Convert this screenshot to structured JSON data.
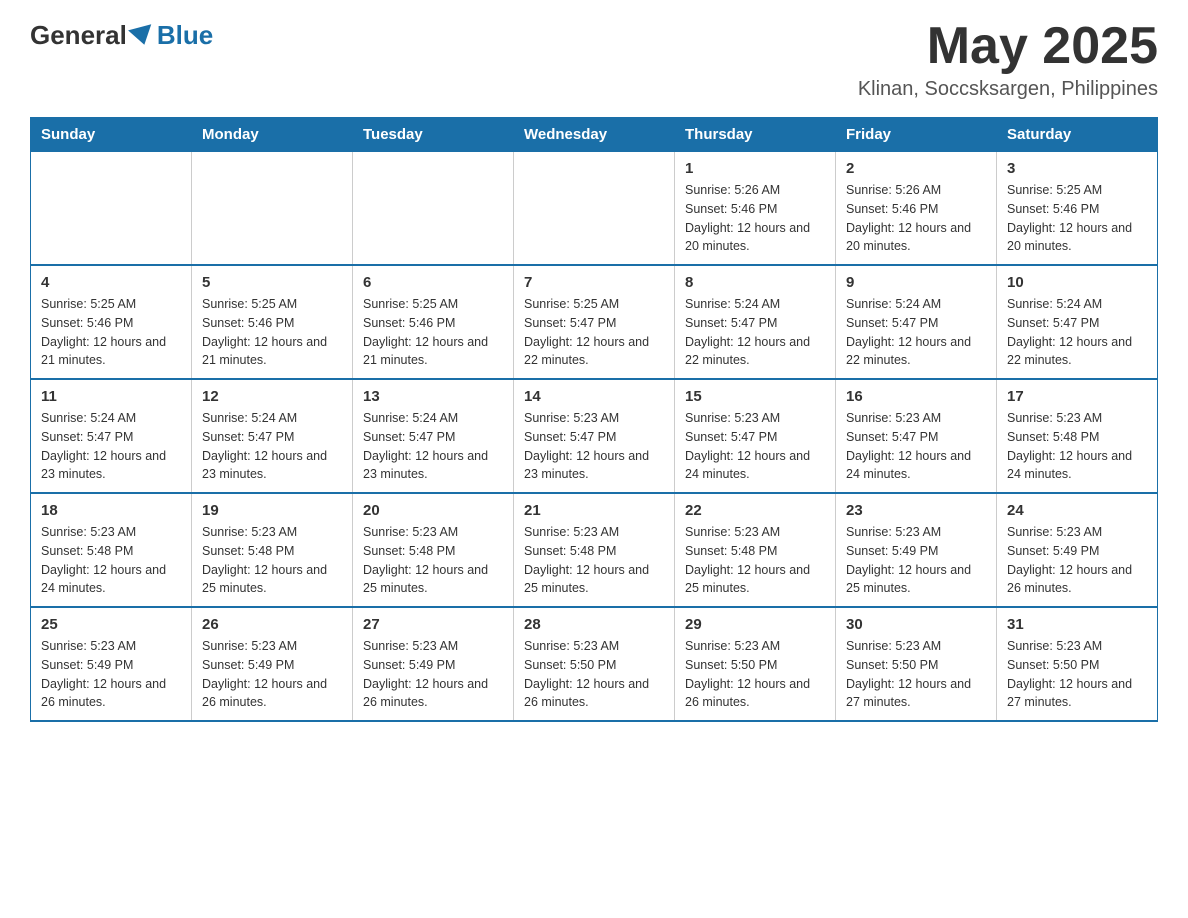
{
  "header": {
    "logo": {
      "general": "General",
      "blue": "Blue"
    },
    "title": "May 2025",
    "location": "Klinan, Soccsksargen, Philippines"
  },
  "days_of_week": [
    "Sunday",
    "Monday",
    "Tuesday",
    "Wednesday",
    "Thursday",
    "Friday",
    "Saturday"
  ],
  "weeks": [
    {
      "days": [
        {
          "number": "",
          "info": ""
        },
        {
          "number": "",
          "info": ""
        },
        {
          "number": "",
          "info": ""
        },
        {
          "number": "",
          "info": ""
        },
        {
          "number": "1",
          "info": "Sunrise: 5:26 AM\nSunset: 5:46 PM\nDaylight: 12 hours and 20 minutes."
        },
        {
          "number": "2",
          "info": "Sunrise: 5:26 AM\nSunset: 5:46 PM\nDaylight: 12 hours and 20 minutes."
        },
        {
          "number": "3",
          "info": "Sunrise: 5:25 AM\nSunset: 5:46 PM\nDaylight: 12 hours and 20 minutes."
        }
      ]
    },
    {
      "days": [
        {
          "number": "4",
          "info": "Sunrise: 5:25 AM\nSunset: 5:46 PM\nDaylight: 12 hours and 21 minutes."
        },
        {
          "number": "5",
          "info": "Sunrise: 5:25 AM\nSunset: 5:46 PM\nDaylight: 12 hours and 21 minutes."
        },
        {
          "number": "6",
          "info": "Sunrise: 5:25 AM\nSunset: 5:46 PM\nDaylight: 12 hours and 21 minutes."
        },
        {
          "number": "7",
          "info": "Sunrise: 5:25 AM\nSunset: 5:47 PM\nDaylight: 12 hours and 22 minutes."
        },
        {
          "number": "8",
          "info": "Sunrise: 5:24 AM\nSunset: 5:47 PM\nDaylight: 12 hours and 22 minutes."
        },
        {
          "number": "9",
          "info": "Sunrise: 5:24 AM\nSunset: 5:47 PM\nDaylight: 12 hours and 22 minutes."
        },
        {
          "number": "10",
          "info": "Sunrise: 5:24 AM\nSunset: 5:47 PM\nDaylight: 12 hours and 22 minutes."
        }
      ]
    },
    {
      "days": [
        {
          "number": "11",
          "info": "Sunrise: 5:24 AM\nSunset: 5:47 PM\nDaylight: 12 hours and 23 minutes."
        },
        {
          "number": "12",
          "info": "Sunrise: 5:24 AM\nSunset: 5:47 PM\nDaylight: 12 hours and 23 minutes."
        },
        {
          "number": "13",
          "info": "Sunrise: 5:24 AM\nSunset: 5:47 PM\nDaylight: 12 hours and 23 minutes."
        },
        {
          "number": "14",
          "info": "Sunrise: 5:23 AM\nSunset: 5:47 PM\nDaylight: 12 hours and 23 minutes."
        },
        {
          "number": "15",
          "info": "Sunrise: 5:23 AM\nSunset: 5:47 PM\nDaylight: 12 hours and 24 minutes."
        },
        {
          "number": "16",
          "info": "Sunrise: 5:23 AM\nSunset: 5:47 PM\nDaylight: 12 hours and 24 minutes."
        },
        {
          "number": "17",
          "info": "Sunrise: 5:23 AM\nSunset: 5:48 PM\nDaylight: 12 hours and 24 minutes."
        }
      ]
    },
    {
      "days": [
        {
          "number": "18",
          "info": "Sunrise: 5:23 AM\nSunset: 5:48 PM\nDaylight: 12 hours and 24 minutes."
        },
        {
          "number": "19",
          "info": "Sunrise: 5:23 AM\nSunset: 5:48 PM\nDaylight: 12 hours and 25 minutes."
        },
        {
          "number": "20",
          "info": "Sunrise: 5:23 AM\nSunset: 5:48 PM\nDaylight: 12 hours and 25 minutes."
        },
        {
          "number": "21",
          "info": "Sunrise: 5:23 AM\nSunset: 5:48 PM\nDaylight: 12 hours and 25 minutes."
        },
        {
          "number": "22",
          "info": "Sunrise: 5:23 AM\nSunset: 5:48 PM\nDaylight: 12 hours and 25 minutes."
        },
        {
          "number": "23",
          "info": "Sunrise: 5:23 AM\nSunset: 5:49 PM\nDaylight: 12 hours and 25 minutes."
        },
        {
          "number": "24",
          "info": "Sunrise: 5:23 AM\nSunset: 5:49 PM\nDaylight: 12 hours and 26 minutes."
        }
      ]
    },
    {
      "days": [
        {
          "number": "25",
          "info": "Sunrise: 5:23 AM\nSunset: 5:49 PM\nDaylight: 12 hours and 26 minutes."
        },
        {
          "number": "26",
          "info": "Sunrise: 5:23 AM\nSunset: 5:49 PM\nDaylight: 12 hours and 26 minutes."
        },
        {
          "number": "27",
          "info": "Sunrise: 5:23 AM\nSunset: 5:49 PM\nDaylight: 12 hours and 26 minutes."
        },
        {
          "number": "28",
          "info": "Sunrise: 5:23 AM\nSunset: 5:50 PM\nDaylight: 12 hours and 26 minutes."
        },
        {
          "number": "29",
          "info": "Sunrise: 5:23 AM\nSunset: 5:50 PM\nDaylight: 12 hours and 26 minutes."
        },
        {
          "number": "30",
          "info": "Sunrise: 5:23 AM\nSunset: 5:50 PM\nDaylight: 12 hours and 27 minutes."
        },
        {
          "number": "31",
          "info": "Sunrise: 5:23 AM\nSunset: 5:50 PM\nDaylight: 12 hours and 27 minutes."
        }
      ]
    }
  ]
}
